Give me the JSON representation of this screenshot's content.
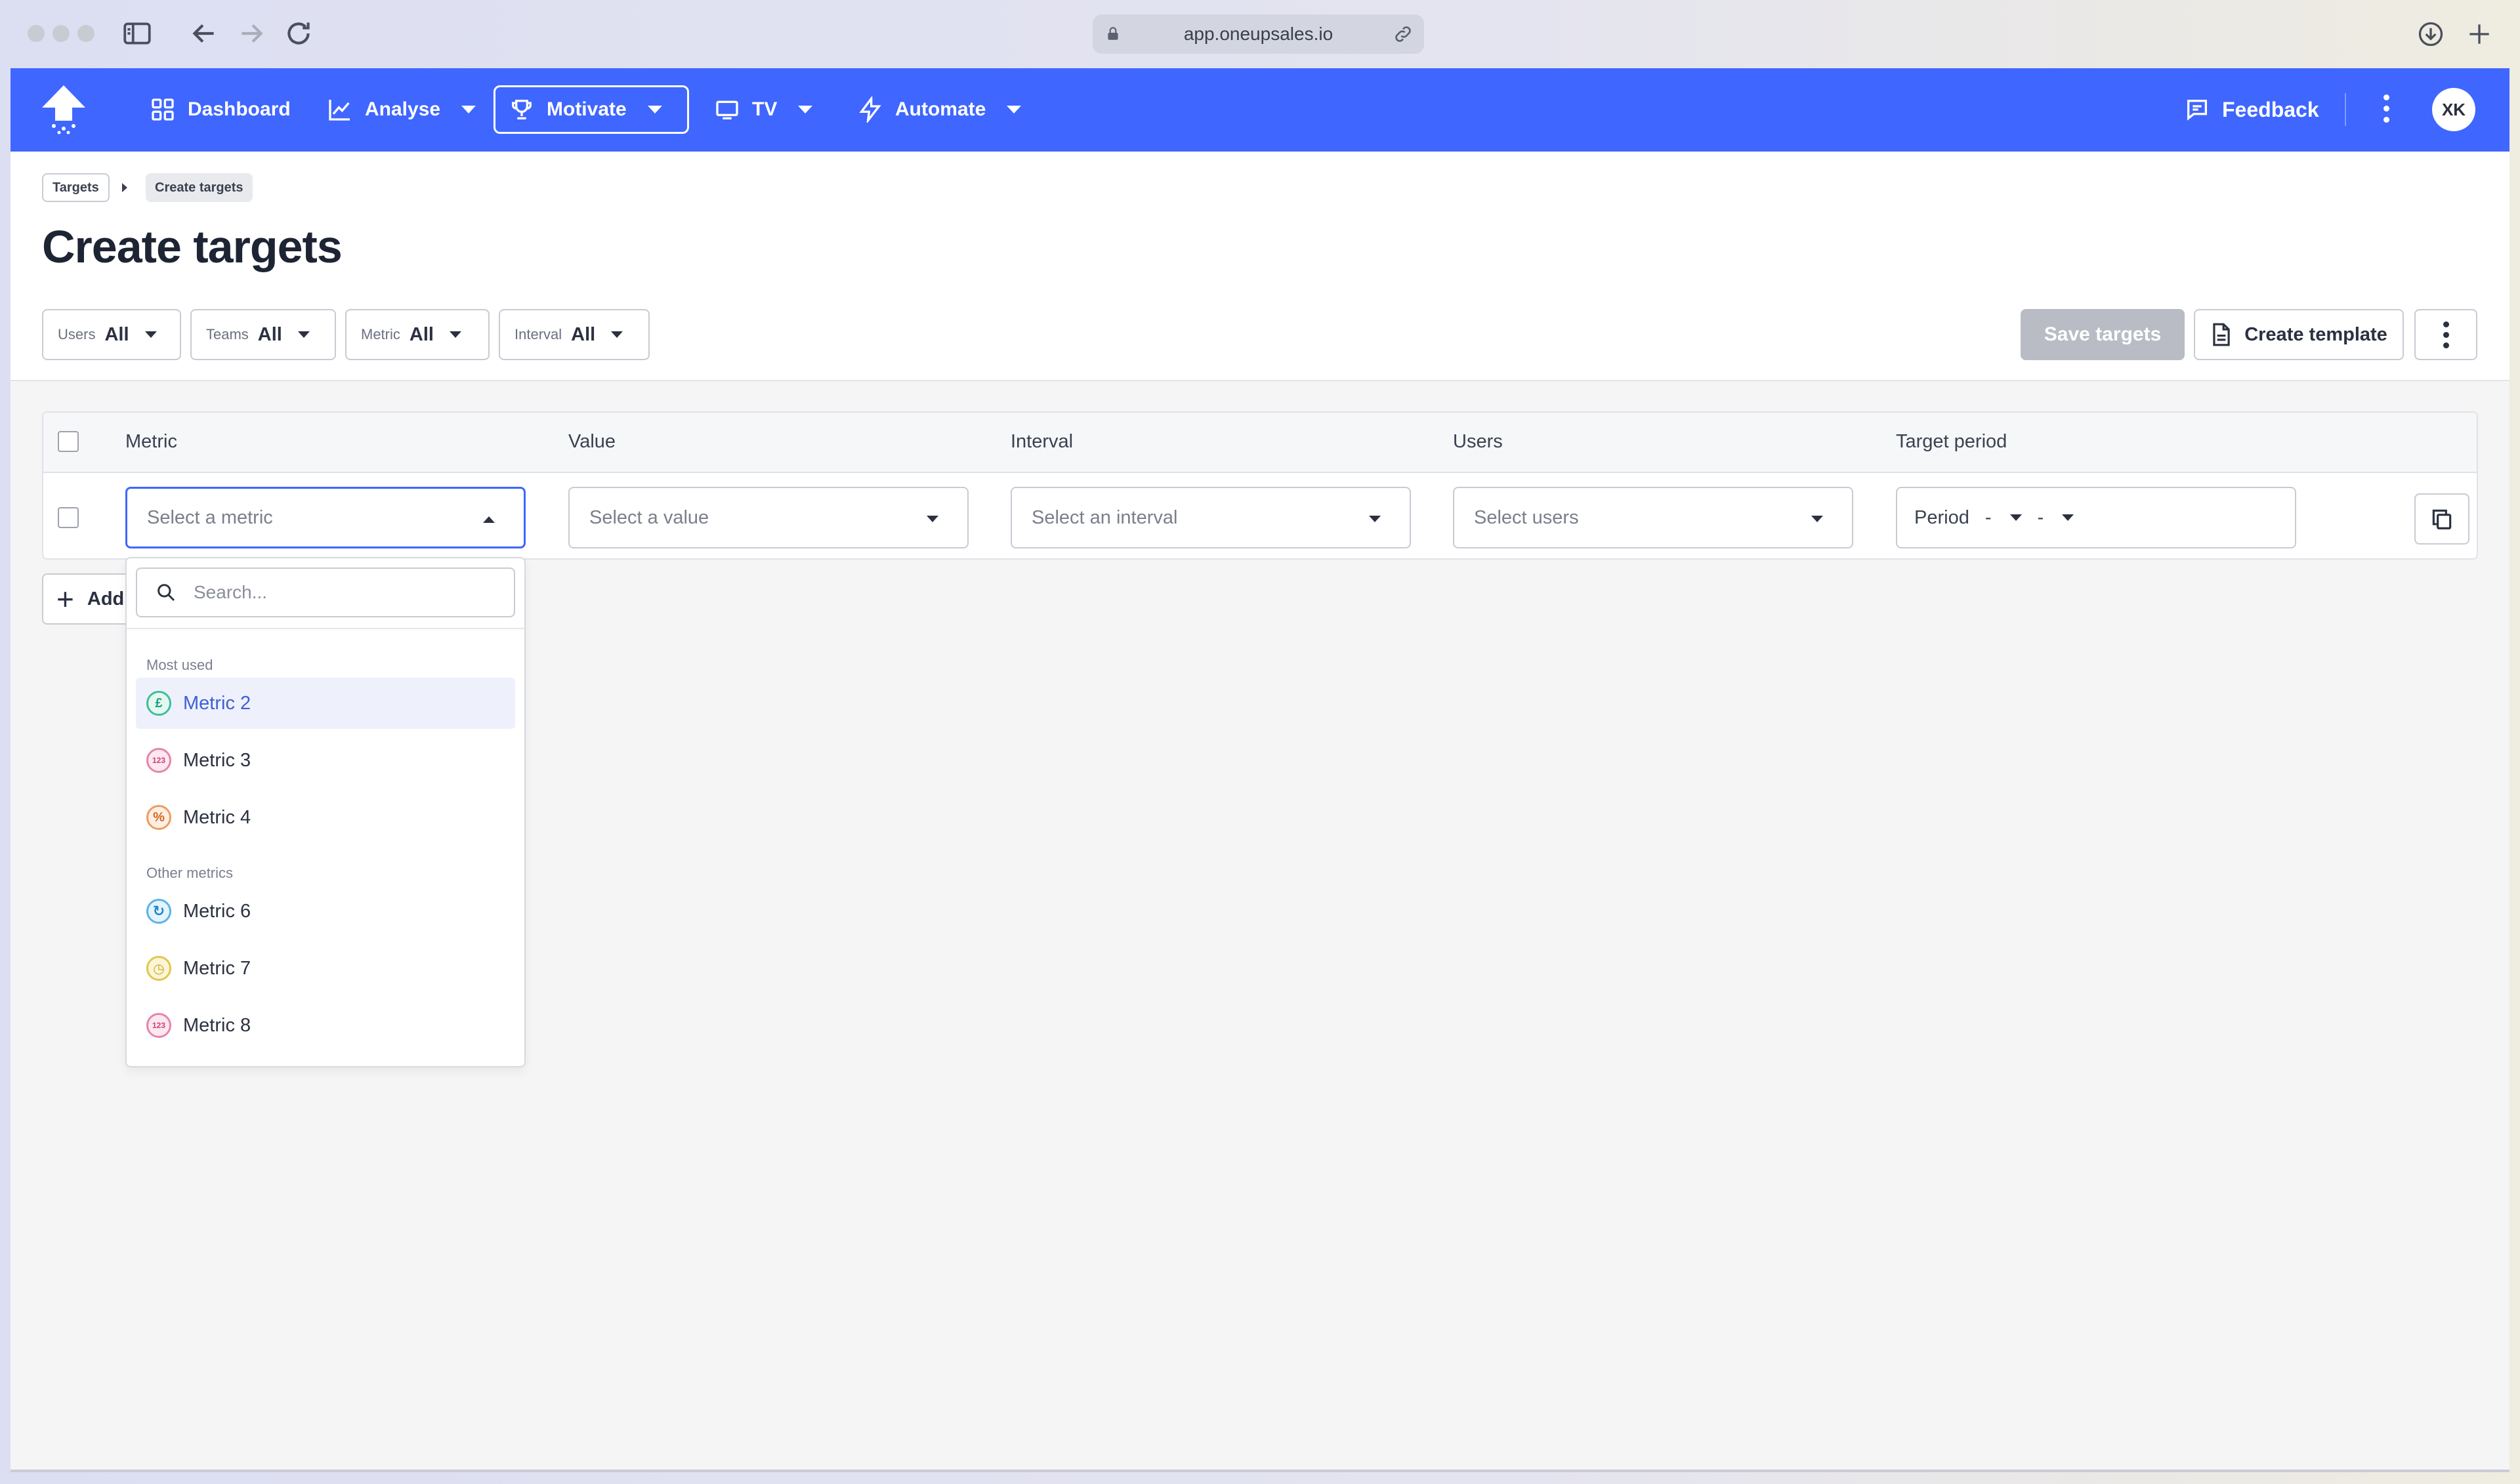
{
  "browser": {
    "url": "app.oneupsales.io"
  },
  "nav": {
    "items": [
      {
        "label": "Dashboard",
        "icon": "grid-icon"
      },
      {
        "label": "Analyse",
        "icon": "chart-line-icon"
      },
      {
        "label": "Motivate",
        "icon": "trophy-icon",
        "active": true
      },
      {
        "label": "TV",
        "icon": "monitor-icon"
      },
      {
        "label": "Automate",
        "icon": "bolt-icon"
      }
    ],
    "feedback_label": "Feedback",
    "avatar_initials": "XK",
    "accent": "#3f66ff"
  },
  "breadcrumb": {
    "items": [
      "Targets",
      "Create targets"
    ]
  },
  "page": {
    "title": "Create targets"
  },
  "filters": [
    {
      "label": "Users",
      "value": "All"
    },
    {
      "label": "Teams",
      "value": "All"
    },
    {
      "label": "Metric",
      "value": "All"
    },
    {
      "label": "Interval",
      "value": "All"
    }
  ],
  "actions": {
    "save_label": "Save targets",
    "template_label": "Create template"
  },
  "table": {
    "columns": [
      "Metric",
      "Value",
      "Interval",
      "Users",
      "Target period"
    ],
    "row": {
      "metric_placeholder": "Select a metric",
      "value_placeholder": "Select a value",
      "interval_placeholder": "Select an interval",
      "users_placeholder": "Select users",
      "period_label": "Period",
      "period_from": "-",
      "period_to": "-"
    },
    "add_row_label": "Add"
  },
  "dropdown": {
    "search_placeholder": "Search...",
    "groups": [
      {
        "label": "Most used",
        "options": [
          {
            "label": "Metric 2",
            "icon": "pound-icon",
            "glyph": "£",
            "highlighted": true
          },
          {
            "label": "Metric 3",
            "icon": "number-icon",
            "glyph": "123"
          },
          {
            "label": "Metric 4",
            "icon": "percent-icon",
            "glyph": "%"
          }
        ]
      },
      {
        "label": "Other metrics",
        "options": [
          {
            "label": "Metric 6",
            "icon": "refresh-icon",
            "glyph": "↻"
          },
          {
            "label": "Metric 7",
            "icon": "clock-icon",
            "glyph": "◷"
          },
          {
            "label": "Metric 8",
            "icon": "number-icon",
            "glyph": "123"
          }
        ]
      }
    ]
  }
}
